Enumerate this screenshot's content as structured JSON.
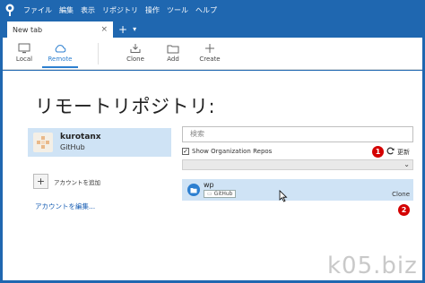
{
  "menu": {
    "items": [
      "ファイル",
      "編集",
      "表示",
      "リポジトリ",
      "操作",
      "ツール",
      "ヘルプ"
    ]
  },
  "tabs": {
    "active_label": "New tab",
    "close_glyph": "×",
    "add_glyph": "+",
    "menu_glyph": "▾"
  },
  "toolbar": {
    "local": "Local",
    "remote": "Remote",
    "clone": "Clone",
    "add": "Add",
    "create": "Create"
  },
  "main": {
    "title": "リモートリポジトリ:",
    "account": {
      "name": "kurotanx",
      "host": "GitHub"
    },
    "add_account": "アカウントを追加",
    "edit_account": "アカウントを編集..."
  },
  "repos": {
    "search_placeholder": "検索",
    "show_org_repos": "Show Organization Repos",
    "show_org_checked": true,
    "refresh_label": "更新",
    "items": [
      {
        "name": "wp",
        "tag": "GitHub",
        "action": "Clone"
      }
    ]
  },
  "annotations": {
    "badge1": "1",
    "badge2": "2"
  },
  "watermark": "k05.biz",
  "colors": {
    "accent": "#1f67b0",
    "selection": "#cfe3f5",
    "badge": "#d40000"
  }
}
